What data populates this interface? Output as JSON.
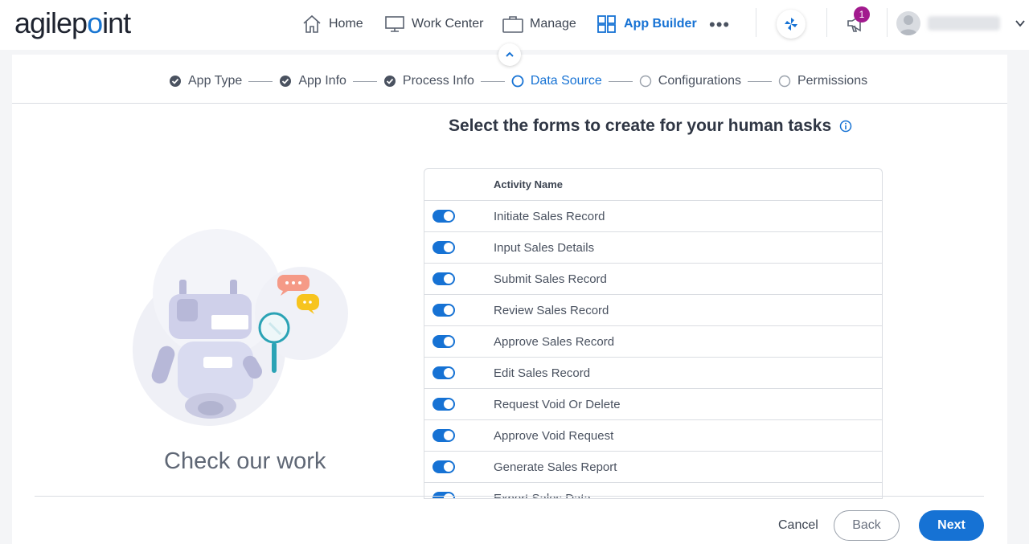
{
  "brand": {
    "logo_left": "agilep",
    "logo_dot": "o",
    "logo_right": "int"
  },
  "nav": {
    "home": "Home",
    "work_center": "Work Center",
    "manage": "Manage",
    "app_builder": "App Builder",
    "more": "•••",
    "notification_count": "1"
  },
  "colors": {
    "accent": "#1672d4",
    "badge": "#a21a8e"
  },
  "steps": [
    {
      "label": "App Type",
      "state": "done"
    },
    {
      "label": "App Info",
      "state": "done"
    },
    {
      "label": "Process Info",
      "state": "done"
    },
    {
      "label": "Data Source",
      "state": "current"
    },
    {
      "label": "Configurations",
      "state": "pending"
    },
    {
      "label": "Permissions",
      "state": "pending"
    }
  ],
  "main": {
    "title": "Select the forms to create for your human tasks",
    "illustration_caption": "Check our work"
  },
  "table": {
    "header": "Activity Name",
    "rows": [
      {
        "name": "Initiate Sales Record",
        "enabled": true
      },
      {
        "name": "Input Sales Details",
        "enabled": true
      },
      {
        "name": "Submit Sales Record",
        "enabled": true
      },
      {
        "name": "Review Sales Record",
        "enabled": true
      },
      {
        "name": "Approve Sales Record",
        "enabled": true
      },
      {
        "name": "Edit Sales Record",
        "enabled": true
      },
      {
        "name": "Request Void Or Delete",
        "enabled": true
      },
      {
        "name": "Approve Void Request",
        "enabled": true
      },
      {
        "name": "Generate Sales Report",
        "enabled": true
      },
      {
        "name": "Export Sales Data",
        "enabled": true
      }
    ]
  },
  "footer": {
    "cancel": "Cancel",
    "back": "Back",
    "next": "Next"
  }
}
